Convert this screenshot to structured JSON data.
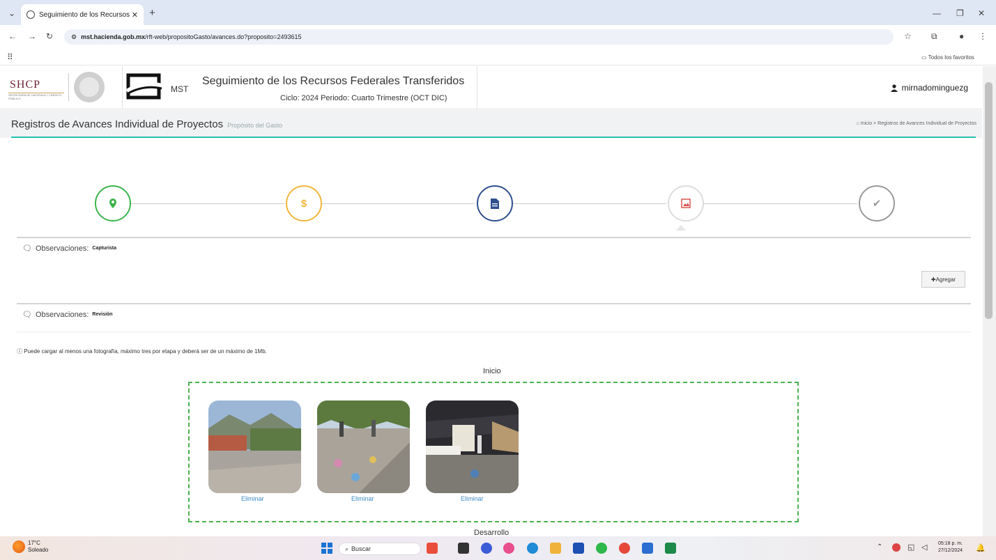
{
  "browser": {
    "tab_title": "Seguimiento de los Recursos F",
    "address": "mst.hacienda.gob.mx/rft-web/propositoGasto/avances.do?proposito=2493615",
    "address_domain": "mst.hacienda.gob.mx",
    "address_path": "/rft-web/propositoGasto/avances.do?proposito=2493615",
    "bookmarks_label": "Todos los favoritos"
  },
  "header": {
    "shcp": "SHCP",
    "shcp_sub": "SECRETARÍA DE HACIENDA Y CRÉDITO PÚBLICO",
    "mst": "MST",
    "title": "Seguimiento de los Recursos Federales Transferidos",
    "subtitle": "Ciclo: 2024   Periodo: Cuarto Trimestre (OCT DIC)",
    "user": "mirnadominguezg"
  },
  "page": {
    "title": "Registros de Avances Individual de Proyectos",
    "subtitle": "Propósito del Gasto",
    "breadcrumb_home": "Inicio",
    "breadcrumb_current": "Registros de Avances Individual de Proyectos"
  },
  "wizard": {
    "steps": [
      {
        "icon": "map-marker-icon",
        "color": "#3cb44b"
      },
      {
        "icon": "dollar-icon",
        "color": "#f0b63a"
      },
      {
        "icon": "document-icon",
        "color": "#2f4f8f"
      },
      {
        "icon": "image-icon",
        "color": "#d9534f"
      },
      {
        "icon": "check-icon",
        "color": "#888888"
      }
    ]
  },
  "observaciones": [
    {
      "label": "Observaciones:",
      "tag": "Capturista"
    },
    {
      "label": "Observaciones:",
      "tag": "Revisión"
    }
  ],
  "add_button": "Agregar",
  "note": "Puede cargar al menos una fotografía, máximo tres por etapa y deberá ser de un máximo de 1Mb.",
  "gallery": {
    "stage": "Inicio",
    "delete_label": "Eliminar",
    "next_stage": "Desarrollo"
  },
  "taskbar": {
    "weather_temp": "17°C",
    "weather_desc": "Soleado",
    "search": "Buscar",
    "time": "05:18 p. m.",
    "date": "27/12/2024"
  }
}
